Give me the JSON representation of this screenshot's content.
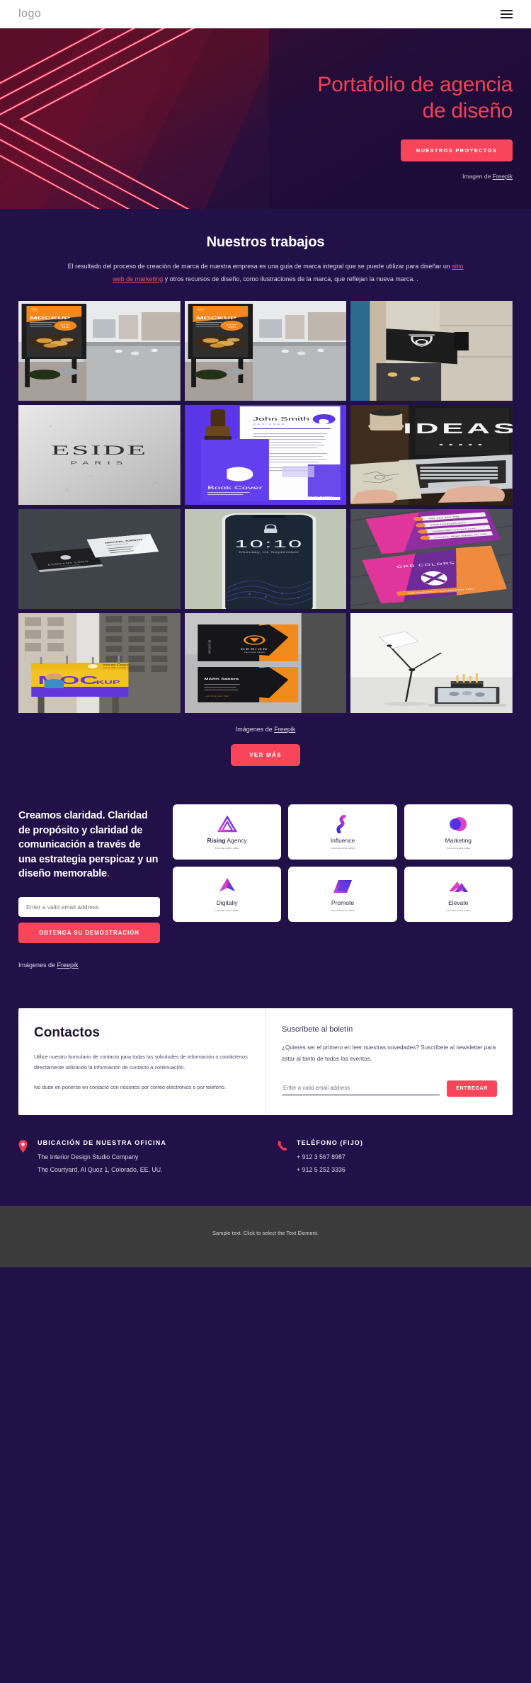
{
  "header": {
    "logo": "logo",
    "menu_icon": "hamburger-icon"
  },
  "hero": {
    "title_line1": "Portafolio de agencia",
    "title_line2": "de diseño",
    "cta": "NUESTROS PROYECTOS",
    "credit_prefix": "Imagen de ",
    "credit_link": "Freepik"
  },
  "works": {
    "heading": "Nuestros trabajos",
    "para_1": "El resultado del proceso de creación de marca de nuestra empresa es una guía de marca integral que se puede utilizar para diseñar un ",
    "para_link": "sitio web de marketing",
    "para_2": " y otros recursos de diseño, como ilustraciones de la marca, que reflejan la nueva marca. .",
    "credit_prefix": "Imágenes de ",
    "credit_link": "Freepik",
    "see_more": "VER MÁS"
  },
  "gallery": [
    {
      "name": "billboard-mockup-street-1",
      "caption": "MOCKUP"
    },
    {
      "name": "billboard-mockup-street-2",
      "caption": "MOCKUP"
    },
    {
      "name": "wall-sign-logo-mockup",
      "caption": ""
    },
    {
      "name": "eside-paris-logo-mockup",
      "caption": "ESIDE PARIS"
    },
    {
      "name": "book-cover-stationery-mockup",
      "caption": "Book Cover"
    },
    {
      "name": "ideas-laptop-desk-photo",
      "caption": "IDEAS"
    },
    {
      "name": "business-card-dark-mockup",
      "caption": ""
    },
    {
      "name": "phone-lockscreen-mockup",
      "caption": "10:10"
    },
    {
      "name": "colorful-business-cards-mockup",
      "caption": "GRB COLORS"
    },
    {
      "name": "outdoor-billboard-mockup",
      "caption": "MOCKUP"
    },
    {
      "name": "black-orange-folder-mockup",
      "caption": "DESIGN"
    },
    {
      "name": "desk-lamp-workspace-photo",
      "caption": ""
    }
  ],
  "clarity": {
    "heading": "Creamos claridad. Claridad de propósito y claridad de comunicación a través de una estrategia perspicaz y un diseño memorable",
    "heading_dot": ".",
    "email_placeholder": "Enter a valid email address",
    "demo_button": "OBTENGA SU DEMOSTRACIÓN",
    "credit_prefix": "Imágenes de ",
    "credit_link": "Freepik",
    "logos": [
      {
        "name": "Rising",
        "name_suffix": " Agency",
        "tagline": "TAGLINE GOES HERE",
        "mark": "triangle-loop-mark"
      },
      {
        "name": "Influence",
        "name_suffix": "",
        "tagline": "TAGLINE GOES HERE",
        "mark": "wave-blob-mark"
      },
      {
        "name": "Marketing",
        "name_suffix": "",
        "tagline": "TAGLINE GOES HERE",
        "mark": "circle-overlap-mark"
      },
      {
        "name": "Digitally",
        "name_suffix": "",
        "tagline": "TAGLINE GOES HERE",
        "mark": "arrow-up-mark"
      },
      {
        "name": "Promote",
        "name_suffix": "",
        "tagline": "TAGLINE GOES HERE",
        "mark": "parallelogram-mark"
      },
      {
        "name": "Elevate",
        "name_suffix": "",
        "tagline": "TAGLINE GOES HERE",
        "mark": "chevron-stack-mark"
      }
    ]
  },
  "contact": {
    "heading": "Contactos",
    "para_1": "Utilice nuestro formulario de contacto para todas las solicitudes de información o contáctenos directamente utilizando la información de contacto a continuación.",
    "para_2": "No dude en ponerse en contacto con nosotros por correo electrónico o por teléfono.",
    "newsletter_heading": "Suscríbete al boletín",
    "newsletter_text": "¿Quieres ser el primero en leer nuestras novedades? Suscríbete al newsletter para estar al tanto de todos los eventos.",
    "newsletter_placeholder": "Enter a valid email address",
    "newsletter_button": "ENTREGAR"
  },
  "info": {
    "office_title": "UBICACIÓN DE NUESTRA OFICINA",
    "office_line1": "The Interior Design Studio Company",
    "office_line2": "The Courtyard, Al Quoz 1, Colorado,  EE. UU.",
    "phone_title": "TELÉFONO (FIJO)",
    "phone_line1": "+ 912 3 567 8987",
    "phone_line2": "+ 912 5 252 3336"
  },
  "footer": {
    "text": "Sample text. Click to select the Text Element."
  },
  "colors": {
    "accent": "#f94559",
    "background": "#221049",
    "hero_dark": "#1a0d38",
    "footer_bg": "#3b3b3b"
  }
}
